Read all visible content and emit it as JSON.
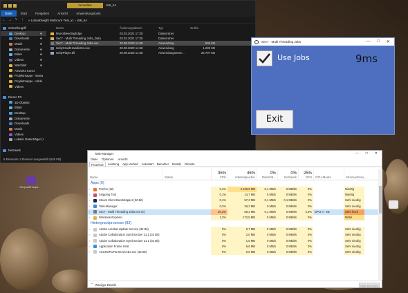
{
  "desktop": {
    "icon_label_1": "SKQuadEinspa..."
  },
  "explorer": {
    "context_tab": "Verwalten",
    "window_title": "x86_64",
    "ribbon_tabs": [
      "Datei",
      "Start",
      "Freigeben",
      "Ansicht",
      "Anwendungstools"
    ],
    "path": "« LatinaDwight Multicore Test_x1 › x86_64",
    "sidebar": [
      {
        "label": "Schnellzugriff",
        "pin": "",
        "color": "#4a90d9"
      },
      {
        "label": "Desktop",
        "pin": "✱",
        "color": "#4aa0e0",
        "selected": true
      },
      {
        "label": "Downloads",
        "pin": "✱",
        "color": "#3b82c4"
      },
      {
        "label": "Musik",
        "pin": "✱",
        "color": "#d97b4a"
      },
      {
        "label": "Dokumente",
        "pin": "✱",
        "color": "#9aa7b5"
      },
      {
        "label": "Bilder",
        "pin": "✱",
        "color": "#5cb3e6"
      },
      {
        "label": "Videos",
        "pin": "✱",
        "color": "#7e5bc2"
      },
      {
        "label": "Watchlist",
        "pin": "✱",
        "color": "#e0b347"
      },
      {
        "label": "Artworks Kunst",
        "pin": "",
        "color": "#e0b347"
      },
      {
        "label": "Projektmappe - Bewa",
        "pin": "",
        "color": "#e0b347"
      },
      {
        "label": "Projektmappe - Hilde",
        "pin": "",
        "color": "#e0b347"
      },
      {
        "label": "Videos",
        "pin": "",
        "color": "#e0b347"
      },
      {
        "label": "",
        "pin": "",
        "color": "transparent"
      },
      {
        "label": "Dieser PC",
        "pin": "",
        "color": "#4a90d9"
      },
      {
        "label": "3D-Objekte",
        "pin": "",
        "color": "#4aa0e0"
      },
      {
        "label": "Bilder",
        "pin": "",
        "color": "#5cb3e6"
      },
      {
        "label": "Desktop",
        "pin": "",
        "color": "#4aa0e0"
      },
      {
        "label": "Dokumente",
        "pin": "",
        "color": "#9aa7b5"
      },
      {
        "label": "Downloads",
        "pin": "",
        "color": "#3b82c4"
      },
      {
        "label": "Musik",
        "pin": "",
        "color": "#d97b4a"
      },
      {
        "label": "Videos",
        "pin": "",
        "color": "#7e5bc2"
      },
      {
        "label": "Lokaler Datenträger (I",
        "pin": "",
        "color": "#9aa7b5"
      },
      {
        "label": "",
        "pin": "",
        "color": "transparent"
      },
      {
        "label": "Netzwerk",
        "pin": "",
        "color": "#4a90d9"
      }
    ],
    "columns": [
      "Name",
      "Änderungsdatum",
      "Typ",
      "Größe"
    ],
    "files": [
      {
        "name": "MonoBleedingEdge",
        "date": "03.02.2021 17:25",
        "type": "Dateiordner",
        "size": "",
        "color": "#e0b347"
      },
      {
        "name": "Sec7 - Multi Threading Jobs_Data",
        "date": "03.02.2021 17:25",
        "type": "Dateiordner",
        "size": "",
        "color": "#e0b347"
      },
      {
        "name": "Sec7 - Multi Threading Jobs.exe",
        "date": "20.08.2020 14:58",
        "type": "Anwendung",
        "size": "636 KB",
        "color": "#6c7a8a",
        "selected": true
      },
      {
        "name": "UnityCrashHandler64.exe",
        "date": "20.08.2020 14:58",
        "type": "Anwendung",
        "size": "1.239 KB",
        "color": "#6c7a8a"
      },
      {
        "name": "UnityPlayer.dll",
        "date": "20.08.2020 14:58",
        "type": "Anwendungserwe...",
        "size": "26.707 KB",
        "color": "#9aa7b5"
      }
    ],
    "status": "5 Elemente   1 Element ausgewählt (635 KB)"
  },
  "mt": {
    "title": "Sec7 - Multi Threading Jobs",
    "win_buttons": [
      "—",
      "□",
      "✕"
    ],
    "checkbox_label": "Use Jobs",
    "checked": true,
    "time": "9ms",
    "exit_label": "Exit"
  },
  "tm": {
    "title": "Task-Manager",
    "win_buttons": [
      "—",
      "□",
      "✕"
    ],
    "menu": [
      "Datei",
      "Optionen",
      "Ansicht"
    ],
    "tabs": [
      "Prozesse",
      "Leistung",
      "App-Verlauf",
      "Autostart",
      "Benutzer",
      "Details",
      "Dienste"
    ],
    "head": {
      "name": "Name",
      "status": "Status",
      "cpu_pct": "35%",
      "cpu": "CPU",
      "mem_pct": "46%",
      "mem": "Arbeitsspeicher",
      "disk_pct": "0%",
      "disk": "Datenträ...",
      "net_pct": "0%",
      "net": "Netzwerk",
      "gpu_pct": "25%",
      "gpu": "GPU",
      "gpueng": "GPU-Modul",
      "trend": "Stromverbrau..."
    },
    "groups": [
      {
        "label": "Apps (6)",
        "rows": [
          {
            "name": "Firefox (12)",
            "status": "",
            "cpu": "0,4%",
            "mem": "2.136,6 MB",
            "disk": "0,1 MB/s",
            "net": "0 MBit/s",
            "gpu": "0%",
            "gpueng": "",
            "trend": "Niedrig",
            "color": "#e6723a"
          },
          {
            "name": "Snipping Tool",
            "status": "",
            "cpu": "0,1%",
            "mem": "14,7 MB",
            "disk": "0 MB/s",
            "net": "0 MBit/s",
            "gpu": "0%",
            "gpueng": "",
            "trend": "Niedrig",
            "color": "#d14d6e"
          },
          {
            "name": "Steam Client Bootstrapper (32 Bit)",
            "status": "",
            "cpu": "0,1%",
            "mem": "57,2 MB",
            "disk": "0,1 MB/s",
            "net": "0,1 MBit/s",
            "gpu": "0%",
            "gpueng": "",
            "trend": "Sehr niedrig",
            "color": "#1b2838"
          },
          {
            "name": "Task-Manager",
            "status": "",
            "cpu": "0,2%",
            "mem": "26,3 MB",
            "disk": "0 MB/s",
            "net": "0 MBit/s",
            "gpu": "0%",
            "gpueng": "",
            "trend": "Sehr niedrig",
            "color": "#3a8ed8"
          },
          {
            "name": "Sec7 - Multi Threading Jobs.exe (2)",
            "status": "",
            "cpu": "30,3%",
            "mem": "58,3 MB",
            "disk": "0,1 MB/s",
            "net": "0 MBit/s",
            "gpu": "4,5%",
            "gpueng": "GPU 0 - 3D",
            "trend": "Sehr hoch",
            "color": "#6c7a8a",
            "selected": true
          },
          {
            "name": "Windows-Explorer",
            "status": "",
            "cpu": "1,3%",
            "mem": "172,5 MB",
            "disk": "0 MB/s",
            "net": "0 MBit/s",
            "gpu": "0%",
            "gpueng": "",
            "trend": "Mittel",
            "color": "#e0b347"
          }
        ]
      },
      {
        "label": "Hintergrundprozesse (83)",
        "rows": [
          {
            "name": "Adobe Acrobat Update Service (32 Bit)",
            "status": "",
            "cpu": "0%",
            "mem": "0,7 MB",
            "disk": "0 MB/s",
            "net": "0 MBit/s",
            "gpu": "0%",
            "gpueng": "",
            "trend": "Sehr niedrig",
            "color": "#c8c8c8"
          },
          {
            "name": "Adobe Collaboration Synchronizer 21.1 (32 Bit)",
            "status": "",
            "cpu": "0%",
            "mem": "2,0 MB",
            "disk": "0 MB/s",
            "net": "0 MBit/s",
            "gpu": "0%",
            "gpueng": "",
            "trend": "Sehr niedrig",
            "color": "#c8c8c8"
          },
          {
            "name": "Adobe Collaboration Synchronizer 21.1 (32 Bit)",
            "status": "",
            "cpu": "0%",
            "mem": "1,5 MB",
            "disk": "0 MB/s",
            "net": "0 MBit/s",
            "gpu": "0%",
            "gpueng": "",
            "trend": "Sehr niedrig",
            "color": "#c8c8c8"
          },
          {
            "name": "Application Frame Host",
            "status": "",
            "cpu": "0%",
            "mem": "6,6 MB",
            "disk": "0 MB/s",
            "net": "0 MBit/s",
            "gpu": "0%",
            "gpueng": "",
            "trend": "Sehr niedrig",
            "color": "#3a8ed8"
          },
          {
            "name": "ASUSGPUFanServiceEx.exe (32 Bit)",
            "status": "",
            "cpu": "0%",
            "mem": "0,6 MB",
            "disk": "0 MB/s",
            "net": "0 MBit/s",
            "gpu": "0%",
            "gpueng": "",
            "trend": "Sehr niedrig",
            "color": "#c8c8c8"
          }
        ]
      }
    ],
    "footer": "Weniger Details",
    "end_task": "Task beenden"
  },
  "colors": {
    "mt_bg": "#4e6fc0",
    "explorer_bg": "#191919",
    "heat_low": "#fff4c4",
    "heat_mid": "#ffe08a",
    "heat_high": "#ffc38a",
    "power_very_high": "#f4a460",
    "selection": "#cce4f7",
    "group_color": "#1f5fbf"
  }
}
